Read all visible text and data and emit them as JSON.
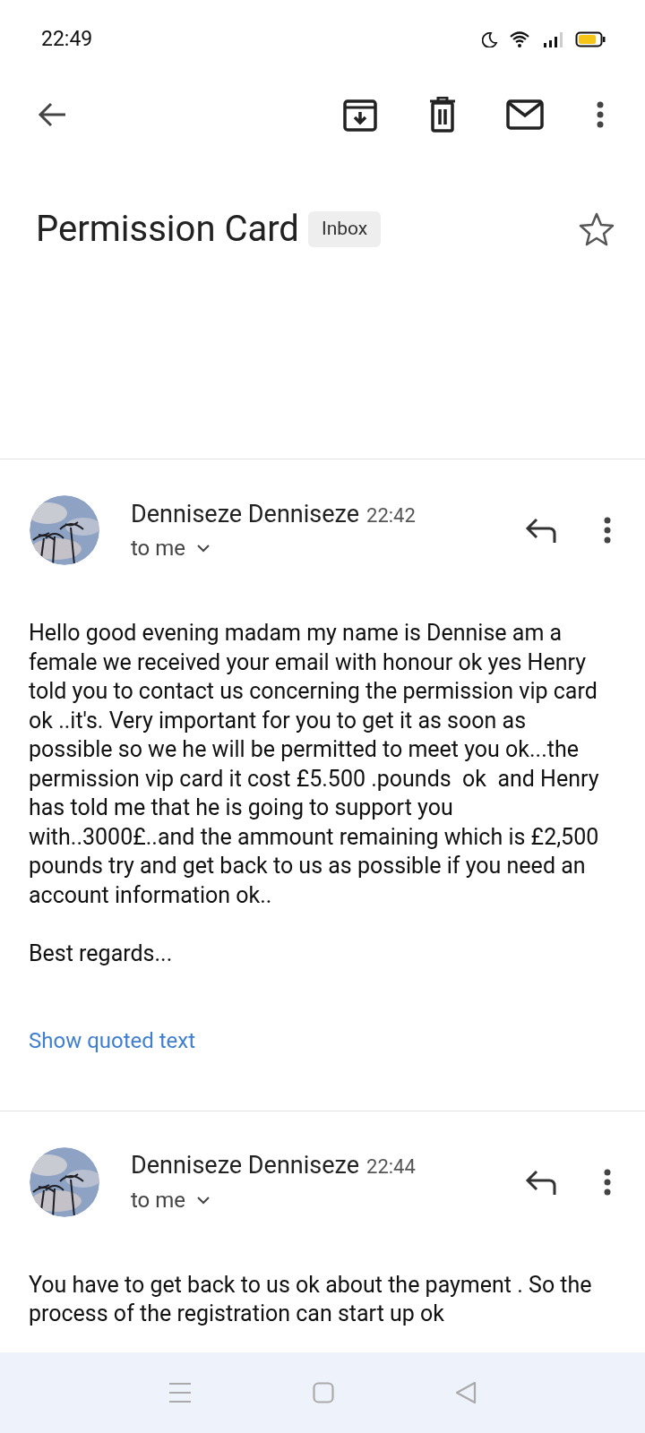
{
  "status_bar": {
    "time": "22:49"
  },
  "subject": {
    "title": "Permission Card",
    "label": "Inbox",
    "starred": false
  },
  "messages": [
    {
      "sender": "Denniseze Denniseze",
      "time": "22:42",
      "recipient": "to me",
      "paragraphs": [
        "Hello good evening madam my name is Dennise am a female we received your email with honour ok yes Henry told you to contact us concerning the permission vip card ok ..it's. Very important for you to get it as soon as possible so we he will be permitted to meet you ok...the permission vip card it cost £5.500 .pounds  ok  and Henry has told me that he is going to support you with..3000£..and the ammount remaining which is £2,500 pounds try and get back to us as possible if you need an account information ok..",
        "Best regards..."
      ],
      "quoted_link": "Show quoted text"
    },
    {
      "sender": "Denniseze Denniseze",
      "time": "22:44",
      "recipient": "to me",
      "paragraphs": [
        "You have to get back to us ok about the payment . So the process of the registration can start up ok"
      ]
    }
  ]
}
